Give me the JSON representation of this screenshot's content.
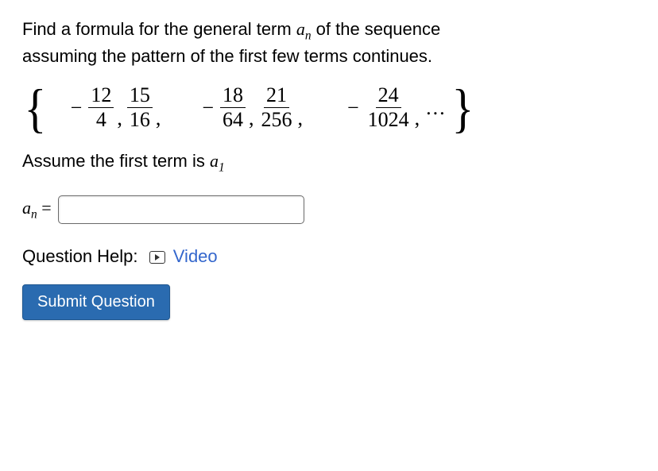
{
  "prompt_line1": "Find a formula for the general term ",
  "prompt_an": "a",
  "prompt_sub_n": "n",
  "prompt_line1b": " of the sequence",
  "prompt_line2": "assuming the pattern of the first few terms continues.",
  "sequence": {
    "terms": [
      {
        "sign": "−",
        "num": "12",
        "den": "4"
      },
      {
        "sign": "",
        "num": "15",
        "den": "16"
      },
      {
        "sign": "−",
        "num": "18",
        "den": "64"
      },
      {
        "sign": "",
        "num": "21",
        "den": "256"
      },
      {
        "sign": "−",
        "num": "24",
        "den": "1024"
      }
    ],
    "ellipsis": "..."
  },
  "assume_text_a": "Assume the first term is ",
  "assume_a": "a",
  "assume_sub": "1",
  "answer_label_a": "a",
  "answer_label_sub": "n",
  "answer_eq": " = ",
  "qhelp_label": "Question Help:",
  "video_label": "Video",
  "submit_label": "Submit Question"
}
